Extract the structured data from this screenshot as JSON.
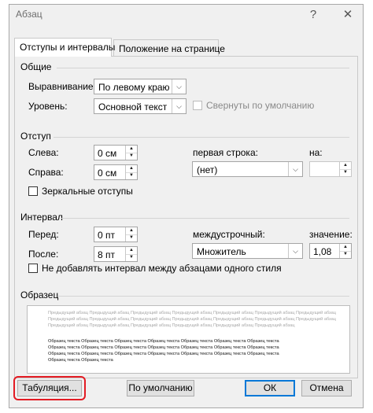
{
  "window": {
    "title": "Абзац",
    "help_glyph": "?",
    "close_glyph": "✕"
  },
  "tabs": [
    {
      "label": "Отступы и интервалы",
      "active": true
    },
    {
      "label": "Положение на странице",
      "active": false
    }
  ],
  "general": {
    "title": "Общие",
    "alignment_label": "Выравнивание:",
    "alignment_value": "По левому краю",
    "level_label": "Уровень:",
    "level_value": "Основной текст",
    "collapsed_label": "Свернуты по умолчанию"
  },
  "indent": {
    "title": "Отступ",
    "left_label": "Слева:",
    "left_value": "0 см",
    "right_label": "Справа:",
    "right_value": "0 см",
    "first_line_label": "первая строка:",
    "first_line_value": "(нет)",
    "by_label": "на:",
    "by_value": "",
    "mirror_label": "Зеркальные отступы"
  },
  "spacing": {
    "title": "Интервал",
    "before_label": "Перед:",
    "before_value": "0 пт",
    "after_label": "После:",
    "after_value": "8 пт",
    "line_label": "междустрочный:",
    "line_value": "Множитель",
    "value_label": "значение:",
    "value_value": "1,08",
    "no_space_label": "Не добавлять интервал между абзацами одного стиля"
  },
  "preview": {
    "title": "Образец",
    "prev_line": "Предыдущий абзац Предыдущий абзац Предыдущий абзац Предыдущий абзац Предыдущий абзац Предыдущий абзац Предыдущий абзац",
    "prev_line_short": "Предыдущий абзац Предыдущий абзац Предыдущий абзац Предыдущий абзац Предыдущий абзац Предыдущий абзац",
    "sample_line": "Образец текста Образец текста Образец текста Образец текста Образец текста Образец текста Образец текста",
    "sample_line_short": "Образец текста Образец текста"
  },
  "buttons": {
    "tabs": "Табуляция...",
    "default": "По умолчанию",
    "ok": "ОК",
    "cancel": "Отмена"
  },
  "colors": {
    "highlight": "#e31b23",
    "default_button_border": "#0078d7"
  },
  "icons": {
    "dropdown": "chevron-down-icon",
    "spin_up": "spin-up-icon",
    "spin_down": "spin-down-icon"
  }
}
